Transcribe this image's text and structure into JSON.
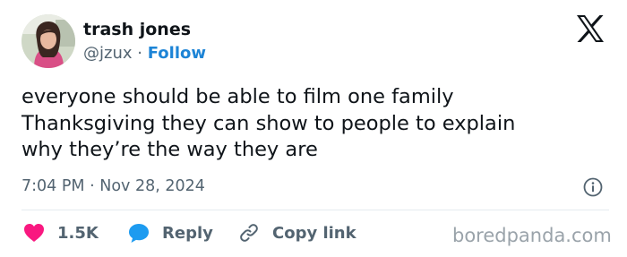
{
  "author": {
    "name": "trash jones",
    "handle": "@jzux",
    "separator": "·",
    "follow_label": "Follow"
  },
  "tweet": {
    "lines": [
      "everyone should be able to film one family",
      "Thanksgiving they can show to people to explain",
      "why they’re the way they are"
    ],
    "time": "7:04 PM",
    "date_separator": "·",
    "date": "Nov 28, 2024"
  },
  "actions": {
    "likes": "1.5K",
    "reply_label": "Reply",
    "copy_label": "Copy link"
  },
  "watermark": "boredpanda.com",
  "icons": {
    "logo": "x-logo-icon",
    "info": "info-icon",
    "like": "heart-icon",
    "reply": "speech-bubble-icon",
    "copy": "link-icon"
  },
  "colors": {
    "text": "#0f1419",
    "muted": "#536471",
    "follow": "#1d84d6",
    "heart": "#f91880",
    "reply_bubble": "#1d9bf0",
    "watermark": "#9aa3aa"
  }
}
